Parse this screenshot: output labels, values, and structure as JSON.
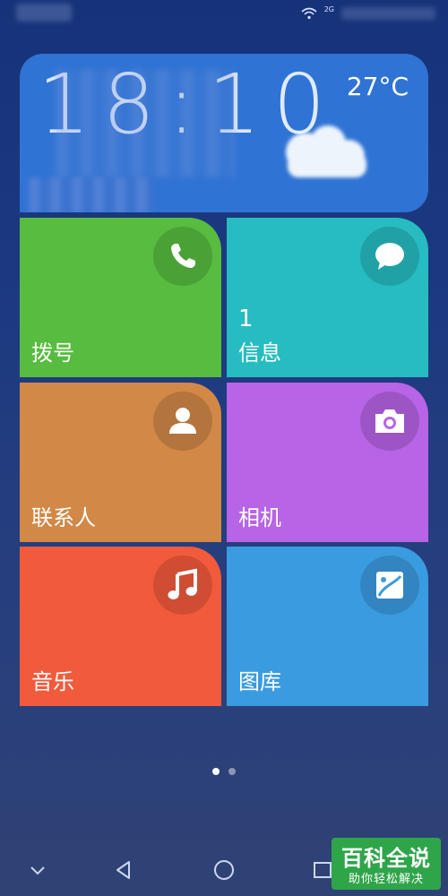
{
  "status_bar": {
    "signal_label": "2G"
  },
  "weather": {
    "time": "18:10",
    "temperature": "27°C",
    "condition_icon": "cloud-icon"
  },
  "tiles": [
    {
      "label": "拨号",
      "icon": "phone-icon",
      "color": "#57bc3f",
      "badge": ""
    },
    {
      "label": "信息",
      "icon": "message-icon",
      "color": "#26bcc1",
      "badge": "1"
    },
    {
      "label": "联系人",
      "icon": "contact-icon",
      "color": "#d28847",
      "badge": ""
    },
    {
      "label": "相机",
      "icon": "camera-icon",
      "color": "#b764e6",
      "badge": ""
    },
    {
      "label": "音乐",
      "icon": "music-icon",
      "color": "#f25a3c",
      "badge": ""
    },
    {
      "label": "图库",
      "icon": "gallery-icon",
      "color": "#3b9be0",
      "badge": ""
    }
  ],
  "pager": {
    "pages": 2,
    "current": 1
  },
  "nav": {
    "buttons": [
      "chevron-down-icon",
      "back-icon",
      "home-icon",
      "recents-icon"
    ]
  },
  "watermark": {
    "title": "百科全说",
    "subtitle": "助你轻松解决"
  }
}
